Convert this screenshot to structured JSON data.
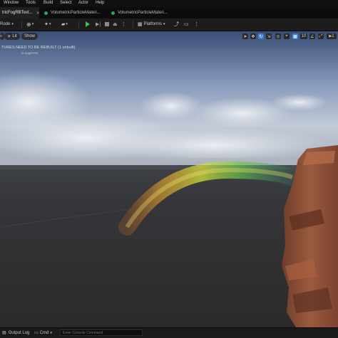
{
  "menu": [
    "Window",
    "Tools",
    "Build",
    "Select",
    "Actor",
    "Help"
  ],
  "tabs": [
    {
      "label": "tricFogRBText..."
    },
    {
      "label": "VolumetricParticleMateri..."
    },
    {
      "label": "VolumetricParticleMateri..."
    }
  ],
  "toolbar": {
    "mode": "Rode",
    "platforms": "Platforms"
  },
  "viewport_toolbar": {
    "lit": "Lit",
    "show": "Show",
    "grid_value": "10",
    "camera_speed": "1"
  },
  "viewport": {
    "warning_line1": "TURES NEED TO BE REBUILT (1 unbuilt)",
    "warning_line2": "to suppress"
  },
  "bottom": {
    "output_log": "Output Log",
    "cmd": "Cmd",
    "console_placeholder": "Enter Console Command"
  },
  "colors": {
    "play": "#3fbf4c",
    "tab_dot": "#2fa35d",
    "accent_select": "#3b7fd6"
  }
}
